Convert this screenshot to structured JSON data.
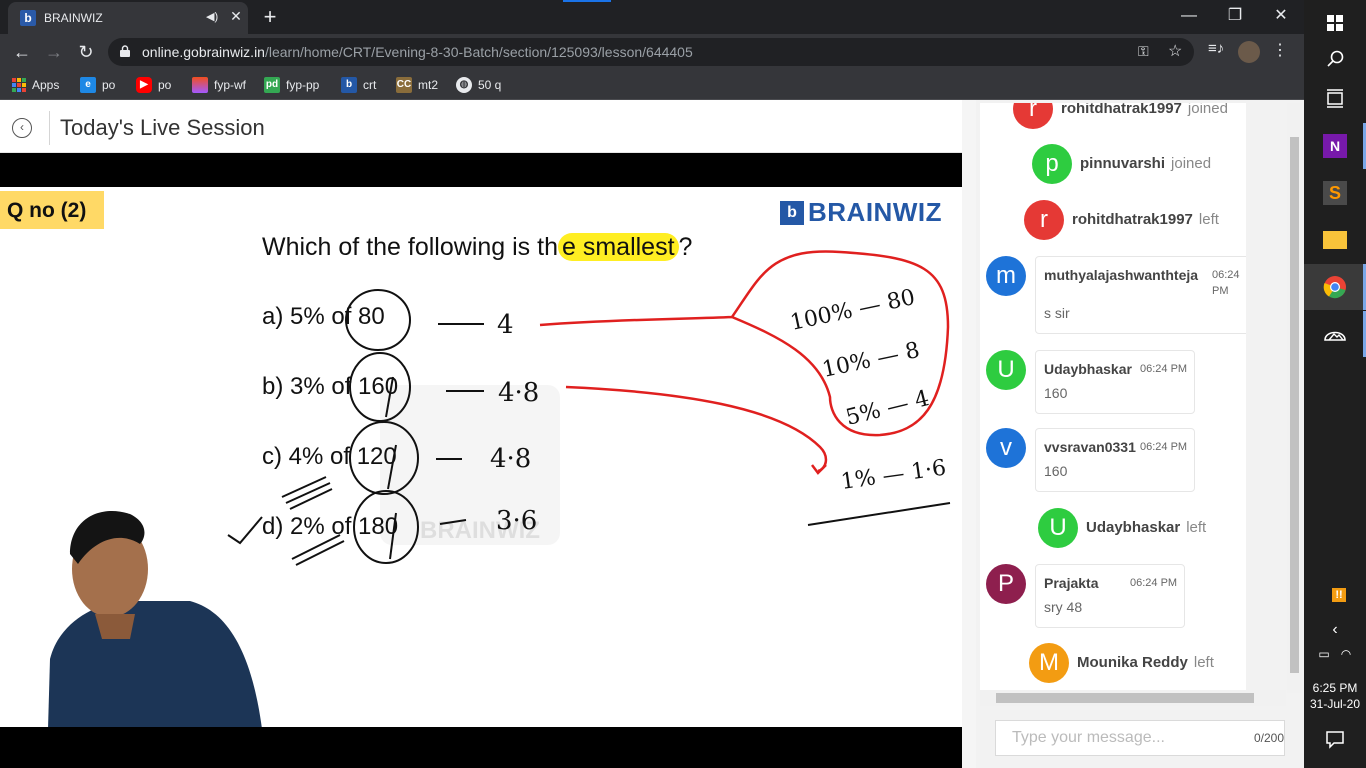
{
  "browser": {
    "tab": {
      "favicon": "b",
      "title": "BRAINWIZ",
      "audio_icon": "speaker-icon",
      "close_icon": "close-icon"
    },
    "window_controls": {
      "minimize": "—",
      "maximize": "❐",
      "close": "✕"
    },
    "address": {
      "host": "online.gobrainwiz.in",
      "path": "/learn/home/CRT/Evening-8-30-Batch/section/125093/lesson/644405"
    },
    "bookmarks": [
      {
        "label": "Apps",
        "icon": "apps-grid-icon",
        "color": "#e8eaed"
      },
      {
        "label": "po",
        "icon": "edge-e-icon",
        "color": "#1e88e5"
      },
      {
        "label": "po",
        "icon": "youtube-icon",
        "color": "#ff0000"
      },
      {
        "label": "fyp-wf",
        "icon": "figma-icon",
        "color": "#f24e1e"
      },
      {
        "label": "fyp-pp",
        "icon": "pdf-icon",
        "color": "#34a853"
      },
      {
        "label": "crt",
        "icon": "brainwiz-icon",
        "color": "#2458a6"
      },
      {
        "label": "mt2",
        "icon": "cc-icon",
        "color": "#8a6d3b"
      },
      {
        "label": "50 q",
        "icon": "globe-icon",
        "color": "#e8eaed"
      }
    ]
  },
  "page": {
    "title": "Today's Live Session"
  },
  "slide": {
    "qno": "Q no (2)",
    "brand": "BRAINWIZ",
    "question_prefix": "Which of the following is th",
    "question_highlight": "e smallest",
    "question_suffix": "?",
    "options": [
      {
        "text": "a) 5% of 80",
        "answer": "4"
      },
      {
        "text": "b) 3% of 160",
        "answer": "4·8"
      },
      {
        "text": "c) 4% of 120",
        "answer": "4·8"
      },
      {
        "text": "d) 2% of 180",
        "answer": "3·6"
      }
    ],
    "working": [
      "100% — 80",
      "10% — 8",
      "5% — 4",
      "1% — 1·6"
    ],
    "watermark": "BRAINWIZ"
  },
  "chat": {
    "events": [
      {
        "initial": "r",
        "name": "rohitdhatrak1997",
        "verb": "joined",
        "color": "#e53935"
      },
      {
        "initial": "p",
        "name": "pinnuvarshi",
        "verb": "joined",
        "color": "#2ecc40"
      },
      {
        "initial": "r",
        "name": "rohitdhatrak1997",
        "verb": "left",
        "color": "#e53935"
      },
      {
        "initial": "U",
        "name": "Udaybhaskar",
        "verb": "left",
        "color": "#2ecc40"
      },
      {
        "initial": "M",
        "name": "Mounika Reddy",
        "verb": "left",
        "color": "#f39c12"
      }
    ],
    "messages": [
      {
        "initial": "m",
        "name": "muthyalajashwanthteja",
        "time": "06:24 PM",
        "text": "s sir",
        "color": "#1e73d8"
      },
      {
        "initial": "U",
        "name": "Udaybhaskar",
        "time": "06:24 PM",
        "text": "160",
        "color": "#2ecc40"
      },
      {
        "initial": "v",
        "name": "vvsravan0331",
        "time": "06:24 PM",
        "text": "160",
        "color": "#1e73d8"
      },
      {
        "initial": "P",
        "name": "Prajakta",
        "time": "06:24 PM",
        "text": "sry 48",
        "color": "#8e1f4e"
      }
    ],
    "input_placeholder": "Type your message...",
    "char_count": "0/200"
  },
  "taskbar": {
    "items": [
      "windows-start-icon",
      "search-icon",
      "task-view-icon",
      "onenote-icon",
      "sublime-icon",
      "file-explorer-icon",
      "chrome-icon",
      "photos-icon"
    ],
    "time": "6:25 PM",
    "date": "31-Jul-20"
  }
}
